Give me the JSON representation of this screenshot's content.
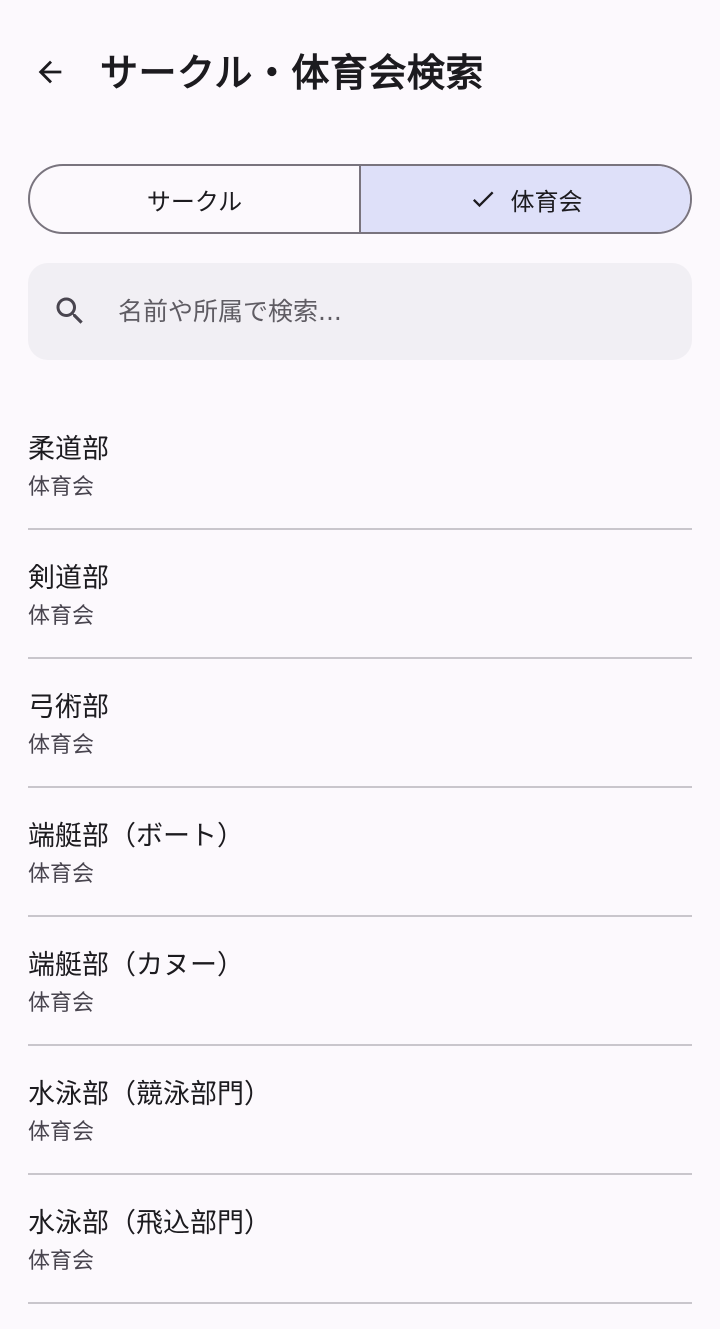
{
  "header": {
    "back_icon": "arrow-back-icon",
    "title": "サークル・体育会検索"
  },
  "segments": {
    "circle_label": "サークル",
    "sports_label": "体育会",
    "selected": "体育会",
    "check_icon": "check-icon"
  },
  "search": {
    "icon": "search-icon",
    "placeholder": "名前や所属で検索...",
    "value": ""
  },
  "colors": {
    "background": "#fcf9fd",
    "selected_segment": "#dee0f9",
    "search_background": "#f1eff4",
    "divider": "#c9c6cc",
    "outline": "#79747e"
  },
  "results": [
    {
      "name": "柔道部",
      "category": "体育会"
    },
    {
      "name": "剣道部",
      "category": "体育会"
    },
    {
      "name": "弓術部",
      "category": "体育会"
    },
    {
      "name": "端艇部（ボート）",
      "category": "体育会"
    },
    {
      "name": "端艇部（カヌー）",
      "category": "体育会"
    },
    {
      "name": "水泳部（競泳部門）",
      "category": "体育会"
    },
    {
      "name": "水泳部（飛込部門）",
      "category": "体育会"
    }
  ]
}
